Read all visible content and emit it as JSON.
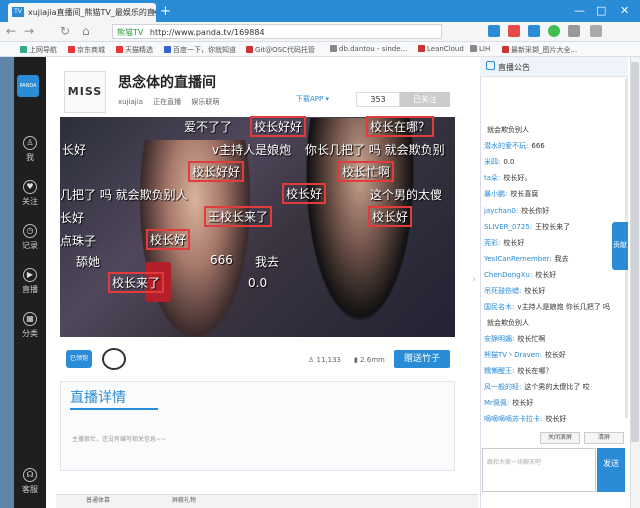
{
  "browser": {
    "tab_title": "xujiajia直播间_熊猫TV_最娱乐的直播",
    "tab_logo": "TV",
    "tab_close": "×",
    "new_tab": "+",
    "window_controls": [
      "—",
      "□",
      "✕"
    ],
    "nav_icons": [
      "←",
      "→",
      "↻",
      "⌂"
    ],
    "address_tag": "熊猫TV",
    "url": "http://www.panda.tv/169884",
    "bookmarks": [
      "上网导航",
      "京东商城",
      "天猫精选",
      "百度一下，你就知道",
      "Git@OSC代码托管",
      "db.dantou - sinde...",
      "LeanCloud",
      "LIH",
      "最新采撷_图片大全..."
    ]
  },
  "sidebar": {
    "logo": "PANDA",
    "items": [
      {
        "label": "我",
        "icon": "person-icon",
        "glyph": "♙"
      },
      {
        "label": "关注",
        "icon": "heart-icon",
        "glyph": "♥"
      },
      {
        "label": "记录",
        "icon": "clock-icon",
        "glyph": "◷"
      },
      {
        "label": "直播",
        "icon": "play-icon",
        "glyph": "▶"
      },
      {
        "label": "分类",
        "icon": "grid-icon",
        "glyph": "▦"
      },
      {
        "label": "客服",
        "icon": "headset-icon",
        "glyph": "☊"
      }
    ]
  },
  "room": {
    "avatar_text": "MISS",
    "title": "思念体的直播间",
    "host": "xujiajia",
    "status": "正在直播",
    "category": "娱乐联萌",
    "app_link": "下载APP ▾",
    "followers": "353",
    "follow_button": "已关注"
  },
  "danmaku": [
    "爱不了了",
    "校长好好",
    "校长在哪？",
    "长好",
    "v主持人是娘炮",
    "你长几把了 吗 就会欺负别",
    "校长好好",
    "校长忙啊",
    "几把了 吗 就会欺负别人",
    "校长好",
    "这个男的太傻",
    "长好",
    "王校长来了",
    "校长好",
    "点珠子",
    "校长好",
    "舔她",
    "666",
    "我去",
    "校长来了",
    "0.0"
  ],
  "video_footer": {
    "tv_badge": "已领饱",
    "fans": "11,133",
    "bamboo": "2.6mm",
    "gift_button": "赠送竹子"
  },
  "details": {
    "title": "直播详情",
    "text": "主播很忙，还没有编写相关信息~~"
  },
  "bottom_bar": {
    "items": [
      "普通体慕",
      "屏蔽礼物"
    ]
  },
  "chat": {
    "header": "直播公告",
    "messages": [
      {
        "user": "",
        "text": "就会欺负别人"
      },
      {
        "user": "潜水的爱不玩:",
        "text": "666"
      },
      {
        "user": "米四:",
        "text": "0.0"
      },
      {
        "user": "ta朵:",
        "text": "校长好。"
      },
      {
        "user": "暴小鹏:",
        "text": "校长喜腐"
      },
      {
        "user": "jaychan0:",
        "text": "校长你好"
      },
      {
        "user": "SLIVER_0725:",
        "text": "王校长来了"
      },
      {
        "user": "莞彩:",
        "text": "校长好"
      },
      {
        "user": "YesICanRemember:",
        "text": "我去"
      },
      {
        "user": "ChenDongXu:",
        "text": "校长好"
      },
      {
        "user": "吊死鼓伤蜡:",
        "text": "校长好"
      },
      {
        "user": "国民名木:",
        "text": "v主持人是娘炮 你长几把了 吗"
      },
      {
        "user": "",
        "text": "就会欺负别人"
      },
      {
        "user": "安静明媚:",
        "text": "校长忙啊"
      },
      {
        "user": "熊猫TV丶Draven:",
        "text": "校长好"
      },
      {
        "user": "糯懒醒王:",
        "text": "校长在哪？"
      },
      {
        "user": "风一般的轻:",
        "text": "这个男的太傻比了 哎"
      },
      {
        "user": "Mr佩佩:",
        "text": "校长好"
      },
      {
        "user": "嘀嘀嘀嘀苏卡拉卡:",
        "text": "校长好"
      }
    ],
    "float_badge": "贡献",
    "clear_screen": "关闭滚屏",
    "clear": "清屏",
    "input_placeholder": "跟和大家一块聊天吧",
    "send": "发送"
  }
}
